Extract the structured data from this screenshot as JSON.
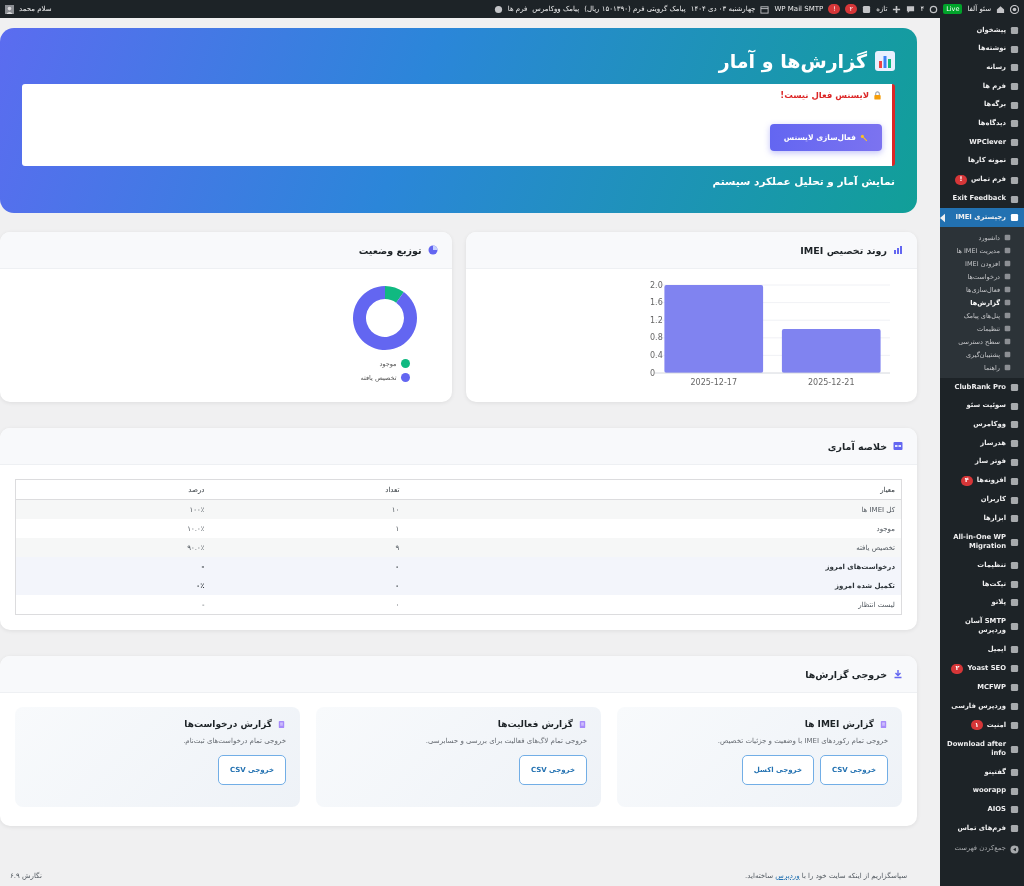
{
  "admin_bar": {
    "site_name": "سئو آلفا",
    "live_badge": "Live",
    "updates": "۴",
    "new_label": "تازه",
    "yoast_badge": "۲",
    "smtp_badge": "!",
    "smtp": "WP Mail SMTP",
    "date": "چهارشنبه ۰۳ دی ۱۴۰۴",
    "sms_credit": "پیامک گرویتی فرم (۱۵۰۱۳۹۰ ریال)",
    "woo_sms": "پیامک ووکامرس",
    "forms": "فرم ها",
    "greeting": "سلام محمد"
  },
  "sidebar": {
    "items": [
      {
        "label": "پیشخوان",
        "selected": false
      },
      {
        "label": "نوشته‌ها",
        "selected": false
      },
      {
        "label": "رسانه",
        "selected": false
      },
      {
        "label": "فرم ها",
        "selected": false
      },
      {
        "label": "برگه‌ها",
        "selected": false
      },
      {
        "label": "دیدگاه‌ها",
        "selected": false
      },
      {
        "label": "WPClever",
        "selected": false
      },
      {
        "label": "نمونه کارها",
        "selected": false
      },
      {
        "label": "فرم تماس",
        "badge": "!",
        "selected": false
      },
      {
        "label": "Exit Feedback",
        "selected": false
      },
      {
        "label": "رجیستری IMEI",
        "selected": true,
        "children": [
          {
            "label": "داشبورد",
            "selected": false
          },
          {
            "label": "مدیریت IMEI ها",
            "selected": false
          },
          {
            "label": "افزودن IMEI",
            "selected": false
          },
          {
            "label": "درخواست‌ها",
            "selected": false
          },
          {
            "label": "فعال‌سازی‌ها",
            "selected": false
          },
          {
            "label": "گزارش‌ها",
            "selected": true
          },
          {
            "label": "پنل‌های پیامک",
            "selected": false
          },
          {
            "label": "تنظیمات",
            "selected": false
          },
          {
            "label": "سطح دسترسی",
            "selected": false
          },
          {
            "label": "پشتیبان‌گیری",
            "selected": false
          },
          {
            "label": "راهنما",
            "selected": false
          }
        ]
      },
      {
        "label": "ClubRank Pro",
        "selected": false
      },
      {
        "label": "سوئیت سئو",
        "selected": false
      },
      {
        "label": "ووکامرس",
        "selected": false
      },
      {
        "label": "هدرساز",
        "selected": false
      },
      {
        "label": "فوتر ساز",
        "selected": false
      },
      {
        "label": "افزونه‌ها",
        "badge": "۴",
        "selected": false
      },
      {
        "label": "کاربران",
        "selected": false
      },
      {
        "label": "ابزارها",
        "selected": false
      },
      {
        "label": "All-in-One WP Migration",
        "selected": false
      },
      {
        "label": "تنظیمات",
        "selected": false
      },
      {
        "label": "تیکت‌ها",
        "selected": false
      },
      {
        "label": "پلاتو",
        "selected": false
      },
      {
        "label": "SMTP آسان وردپرس",
        "selected": false
      },
      {
        "label": "ایمیل",
        "selected": false
      },
      {
        "label": "Yoast SEO",
        "badge": "۲",
        "selected": false
      },
      {
        "label": "MCFWP",
        "selected": false
      },
      {
        "label": "وردپرس فارسی",
        "selected": false
      },
      {
        "label": "امنیت",
        "badge": "۱",
        "selected": false
      },
      {
        "label": "Download after info",
        "selected": false
      },
      {
        "label": "گفتینو",
        "selected": false
      },
      {
        "label": "woorapp",
        "selected": false
      },
      {
        "label": "AIOS",
        "selected": false
      },
      {
        "label": "فرم‌های تماس",
        "selected": false
      }
    ],
    "collapse": "جمع‌کردن فهرست"
  },
  "header": {
    "title": "گزارش‌ها و آمار",
    "license_message": "لایسنس فعال نیست!",
    "license_button": "فعال‌سازی لایسنس",
    "subtitle": "نمایش آمار و تحلیل عملکرد سیستم"
  },
  "trend_card": {
    "title": "روند تخصیص IMEI",
    "chart_data": {
      "type": "bar",
      "grid": true,
      "categories": [
        "2025-12-17",
        "2025-12-21"
      ],
      "values": [
        2,
        1
      ],
      "ylim": [
        0,
        2
      ],
      "yticks": [
        0,
        {
          "value": 0.4,
          "label": "0.4"
        },
        {
          "value": 0.8,
          "label": "0.8"
        },
        {
          "value": 1.2,
          "label": "1.2"
        },
        {
          "value": 1.6,
          "label": "1.6"
        },
        {
          "value": 2,
          "label": "2.0"
        }
      ]
    }
  },
  "status_card": {
    "title": "توزیع وضعیت",
    "chart_data": {
      "type": "donut",
      "categories": [
        "موجود",
        "تخصیص یافته"
      ],
      "values": [
        10,
        90
      ],
      "colors": [
        "#10b981",
        "#6366f1"
      ]
    }
  },
  "summary": {
    "title": "خلاصه آماری",
    "columns": [
      "معیار",
      "تعداد",
      "درصد"
    ],
    "rows": [
      {
        "cells": [
          "کل IMEI ها",
          "۱۰",
          "۱۰۰٪"
        ],
        "emphasized": false
      },
      {
        "cells": [
          "موجود",
          "۱",
          "۱۰.۰٪"
        ],
        "emphasized": false
      },
      {
        "cells": [
          "تخصیص یافته",
          "۹",
          "۹۰.۰٪"
        ],
        "emphasized": false
      },
      {
        "cells": [
          "درخواست‌های امروز",
          "۰",
          "-"
        ],
        "emphasized": true
      },
      {
        "cells": [
          "تکمیل شده امروز",
          "۰",
          "۰٪"
        ],
        "emphasized": true
      },
      {
        "cells": [
          "لیست انتظار",
          "۰",
          "-"
        ],
        "emphasized": false
      }
    ]
  },
  "exports": {
    "title": "خروجی گزارش‌ها",
    "cards": [
      {
        "title": "گزارش IMEI ها",
        "description": "خروجی تمام رکوردهای IMEI با وضعیت و جزئیات تخصیص.",
        "buttons": [
          "خروجی CSV",
          "خروجی اکسل"
        ]
      },
      {
        "title": "گزارش فعالیت‌ها",
        "description": "خروجی تمام لاگ‌های فعالیت برای بررسی و حسابرسی.",
        "buttons": [
          "خروجی CSV"
        ]
      },
      {
        "title": "گزارش درخواست‌ها",
        "description": "خروجی تمام درخواست‌های ثبت‌نام.",
        "buttons": [
          "خروجی CSV"
        ]
      }
    ]
  },
  "footer": {
    "thanks_before": "سپاسگزاریم از اینکه سایت خود را با",
    "link": "وردپرس",
    "thanks_after": "ساخته‌اید.",
    "version": "نگارش ۶.۹"
  }
}
